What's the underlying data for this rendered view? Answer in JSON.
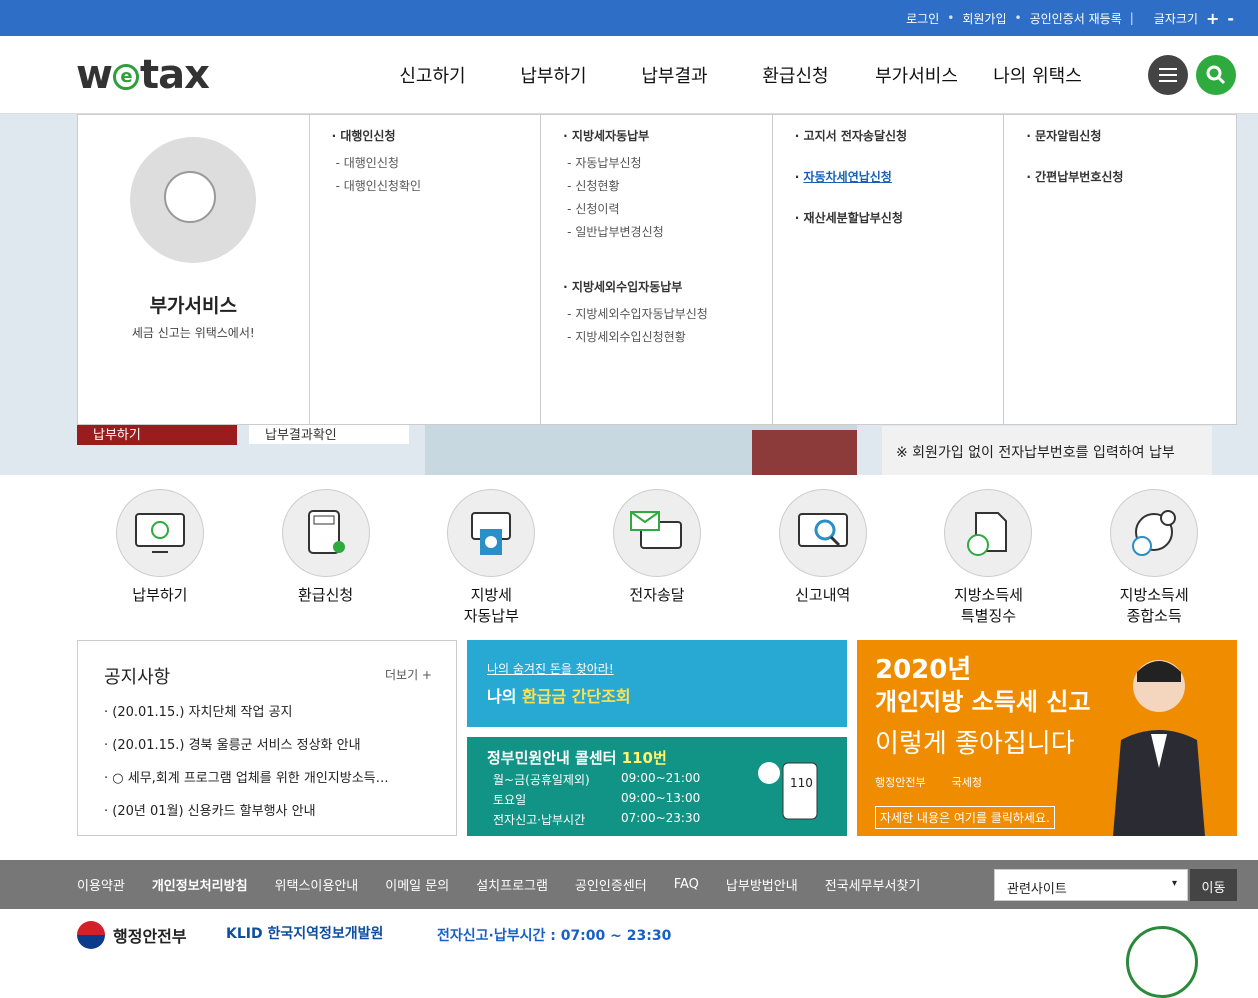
{
  "topbar": {
    "login": "로그인",
    "join": "회원가입",
    "cert": "공인인증서 재등록",
    "font_size": "글자크기",
    "plus": "+",
    "minus": "-"
  },
  "header": {
    "logo": "wetax",
    "nav": [
      "신고하기",
      "납부하기",
      "납부결과",
      "환급신청",
      "부가서비스",
      "나의 위택스"
    ]
  },
  "mega": {
    "intro_title": "부가서비스",
    "intro_sub": "세금 신고는 위택스에서!",
    "col1": {
      "group": "대행인신청",
      "items": [
        "대행인신청",
        "대행인신청확인"
      ]
    },
    "col2": {
      "group1": "지방세자동납부",
      "items1": [
        "자동납부신청",
        "신청현황",
        "신청이력",
        "일반납부변경신청"
      ],
      "group2": "지방세외수입자동납부",
      "items2": [
        "지방세외수입자동납부신청",
        "지방세외수입신청현황"
      ]
    },
    "col3": {
      "items": [
        "고지서 전자송달신청",
        "자동차세연납신청",
        "재산세분할납부신청"
      ]
    },
    "col4": {
      "items": [
        "문자알림신청",
        "간편납부번호신청"
      ]
    }
  },
  "hero": {
    "btn_red": "납부하기",
    "btn_white": "납부결과확인",
    "notice": "※ 회원가입 없이 전자납부번호를 입력하여 납부"
  },
  "quick": [
    {
      "line1": "납부하기",
      "line2": "",
      "icon": "monitor-e-icon"
    },
    {
      "line1": "환급신청",
      "line2": "",
      "icon": "calculator-icon"
    },
    {
      "line1": "지방세",
      "line2": "자동납부",
      "icon": "atm-icon"
    },
    {
      "line1": "전자송달",
      "line2": "",
      "icon": "mail-monitor-icon"
    },
    {
      "line1": "신고내역",
      "line2": "",
      "icon": "search-monitor-icon"
    },
    {
      "line1": "지방소득세",
      "line2": "특별징수",
      "icon": "document-won-icon"
    },
    {
      "line1": "지방소득세",
      "line2": "종합소득",
      "icon": "chart-won-icon"
    }
  ],
  "notice": {
    "title": "공지사항",
    "more": "더보기 +",
    "items": [
      "(20.01.15.) 자치단체 작업 공지",
      "(20.01.15.) 경북 울릉군 서비스 정상화 안내",
      "○ 세무,회계 프로그램 업체를 위한 개인지방소득…",
      "(20년 01월) 신용카드 할부행사 안내"
    ]
  },
  "banner1": {
    "sub": "나의 숨겨진 돈을 찾아라!",
    "main_pre": "나의 ",
    "main_em": "환급금 간단조회"
  },
  "banner2": {
    "title_pre": "정부민원안내 콜센터 ",
    "title_em": "110번",
    "rows": [
      {
        "k": "월~금(공휴일제외)",
        "v": "09:00~21:00"
      },
      {
        "k": "토요일",
        "v": "09:00~13:00"
      },
      {
        "k": "전자신고·납부시간",
        "v": "07:00~23:30"
      }
    ],
    "phone": "110"
  },
  "banner3": {
    "l1": "2020년",
    "l2": "개인지방 소득세 신고",
    "l3": "이렇게 좋아집니다",
    "org1": "행정안전부",
    "org2": "국세청",
    "cta": "자세한 내용은 여기를 클릭하세요."
  },
  "footer_nav": {
    "items": [
      "이용약관",
      "개인정보처리방침",
      "위택스이용안내",
      "이메일 문의",
      "설치프로그램",
      "공인인증센터",
      "FAQ",
      "납부방법안내",
      "전국세무부서찾기"
    ],
    "related": "관련사이트",
    "go": "이동"
  },
  "footer": {
    "mois": "행정안전부",
    "klid": "KLID 한국지역정보개발원",
    "time": "전자신고·납부시간 : 07:00 ~ 23:30"
  },
  "colors": {
    "top": "#2f6ec6",
    "green": "#2eaa3e",
    "red": "#9b1c1f",
    "orange": "#f08c00",
    "teal": "#119486",
    "sky": "#27a9d4"
  }
}
